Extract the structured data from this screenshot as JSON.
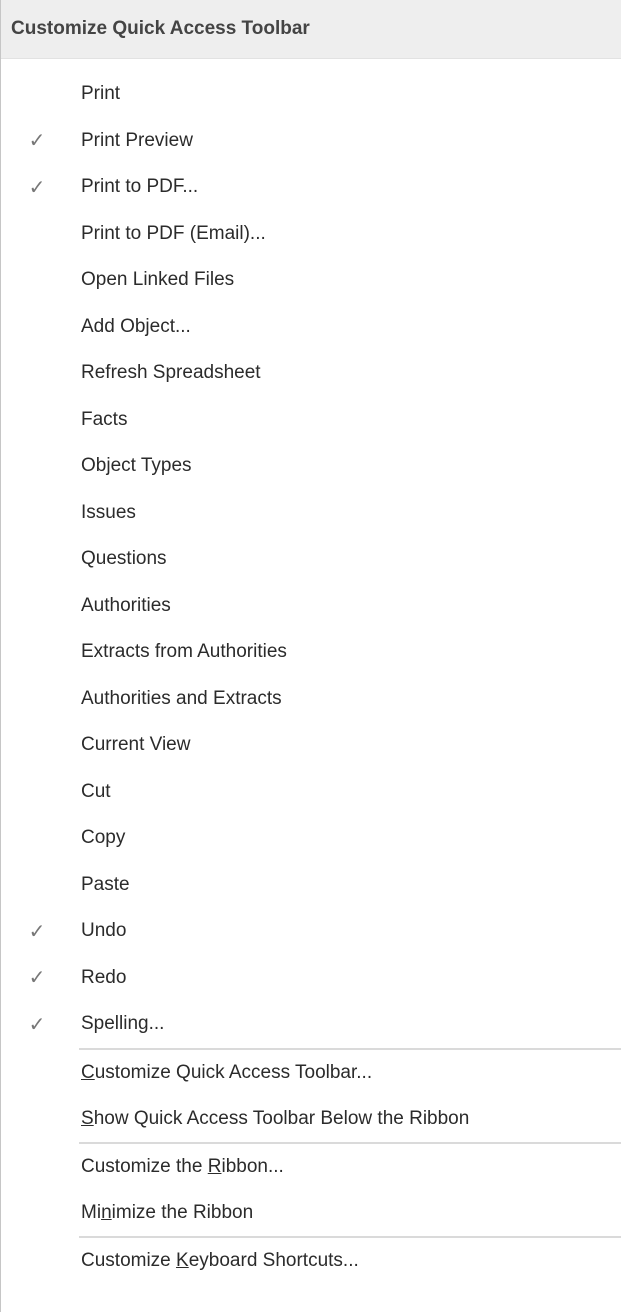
{
  "menu": {
    "title": "Customize Quick Access Toolbar",
    "items": [
      {
        "label": "Print",
        "checked": false
      },
      {
        "label": "Print Preview",
        "checked": true
      },
      {
        "label": "Print to PDF...",
        "checked": true
      },
      {
        "label": "Print to PDF (Email)...",
        "checked": false
      },
      {
        "label": "Open Linked Files",
        "checked": false
      },
      {
        "label": "Add Object...",
        "checked": false
      },
      {
        "label": "Refresh Spreadsheet",
        "checked": false
      },
      {
        "label": "Facts",
        "checked": false
      },
      {
        "label": "Object Types",
        "checked": false
      },
      {
        "label": "Issues",
        "checked": false
      },
      {
        "label": "Questions",
        "checked": false
      },
      {
        "label": "Authorities",
        "checked": false
      },
      {
        "label": "Extracts from Authorities",
        "checked": false
      },
      {
        "label": "Authorities and Extracts",
        "checked": false
      },
      {
        "label": "Current View",
        "checked": false
      },
      {
        "label": "Cut",
        "checked": false
      },
      {
        "label": "Copy",
        "checked": false
      },
      {
        "label": "Paste",
        "checked": false
      },
      {
        "label": "Undo",
        "checked": true
      },
      {
        "label": "Redo",
        "checked": true
      },
      {
        "label": "Spelling...",
        "checked": true
      }
    ],
    "check_glyph": "✓",
    "commands": {
      "customize_qat": {
        "pre": "",
        "mnemonic": "C",
        "post": "ustomize Quick Access Toolbar..."
      },
      "show_below": {
        "pre": "",
        "mnemonic": "S",
        "post": "how Quick Access Toolbar Below the Ribbon"
      },
      "customize_ribbon": {
        "pre": "Customize the ",
        "mnemonic": "R",
        "post": "ibbon..."
      },
      "minimize_ribbon": {
        "pre": "Mi",
        "mnemonic": "n",
        "post": "imize the Ribbon"
      },
      "keyboard_shortcuts": {
        "pre": "Customize ",
        "mnemonic": "K",
        "post": "eyboard Shortcuts..."
      }
    }
  }
}
